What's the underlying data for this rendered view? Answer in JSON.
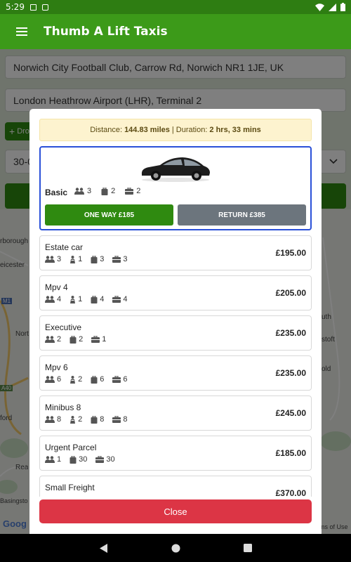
{
  "status_bar": {
    "time": "5:29"
  },
  "app_bar": {
    "title": "Thumb A Lift Taxis"
  },
  "form": {
    "pickup_value": "Norwich City Football Club, Carrow Rd, Norwich NR1 1JE, UK",
    "dropoff_value": "London Heathrow Airport (LHR), Terminal 2",
    "add_drop_partial": "Dro",
    "date_partial": "30-0"
  },
  "map_labels": {
    "left": [
      "rborough",
      "eicester",
      "M1",
      "Nort",
      "A40",
      "ford",
      "Rea",
      "Basingsto",
      "Goog"
    ],
    "right": [
      "uth",
      "stoft",
      "old",
      "rms of Use"
    ]
  },
  "modal": {
    "distance_label": "Distance:",
    "distance_value": "144.83 miles",
    "separator": "|",
    "duration_label": "Duration:",
    "duration_value": "2 hrs, 33 mins",
    "selected": {
      "name": "Basic",
      "passengers": "3",
      "suitcases": "2",
      "bags": "2",
      "one_way_label": "ONE WAY £185",
      "return_label": "RETURN £385"
    },
    "vehicles": [
      {
        "name": "Estate car",
        "passengers": "3",
        "child_seats": "1",
        "suitcases": "3",
        "bags": "3",
        "price": "£195.00"
      },
      {
        "name": "Mpv 4",
        "passengers": "4",
        "child_seats": "1",
        "suitcases": "4",
        "bags": "4",
        "price": "£205.00"
      },
      {
        "name": "Executive",
        "passengers": "2",
        "suitcases": "2",
        "bags": "1",
        "price": "£235.00"
      },
      {
        "name": "Mpv 6",
        "passengers": "6",
        "child_seats": "2",
        "suitcases": "6",
        "bags": "6",
        "price": "£235.00"
      },
      {
        "name": "Minibus 8",
        "passengers": "8",
        "child_seats": "2",
        "suitcases": "8",
        "bags": "8",
        "price": "£245.00"
      },
      {
        "name": "Urgent Parcel",
        "passengers": "1",
        "suitcases": "30",
        "bags": "30",
        "price": "£185.00"
      },
      {
        "name": "Small Freight",
        "price": "£370.00"
      }
    ],
    "close_label": "Close"
  },
  "colors": {
    "app_green": "#3c9a19",
    "status_green": "#2e7d12",
    "button_green": "#2f8a10",
    "return_grey": "#6c757d",
    "close_red": "#dc3545",
    "selected_border": "#2a50d8",
    "info_bg": "#fdf3cf"
  }
}
